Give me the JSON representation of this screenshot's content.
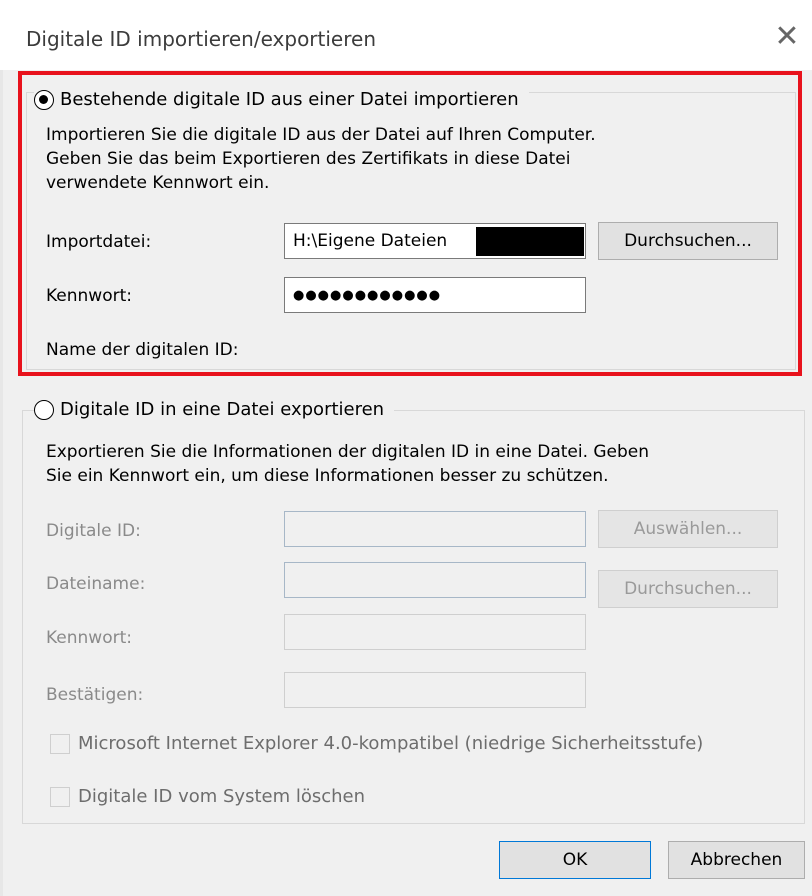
{
  "window": {
    "title": "Digitale ID importieren/exportieren",
    "close_icon": "close-icon"
  },
  "import_section": {
    "radio_label": "Bestehende digitale ID aus einer Datei importieren",
    "selected": true,
    "description_line1": "Importieren Sie die digitale ID aus der Datei auf Ihren Computer.",
    "description_line2": "Geben Sie das beim Exportieren des Zertifikats in diese Datei",
    "description_line3": "verwendete Kennwort ein.",
    "import_file_label": "Importdatei:",
    "import_file_value": "H:\\Eigene Dateien",
    "browse_button": "Durchsuchen...",
    "password_label": "Kennwort:",
    "password_value": "●●●●●●●●●●●●",
    "digital_id_name_label": "Name der digitalen ID:"
  },
  "export_section": {
    "radio_label": "Digitale ID in eine Datei exportieren",
    "selected": false,
    "description_line1": "Exportieren Sie die Informationen der digitalen ID in eine Datei. Geben",
    "description_line2": "Sie ein Kennwort ein, um diese Informationen besser zu schützen.",
    "digital_id_label": "Digitale ID:",
    "select_button": "Auswählen...",
    "filename_label": "Dateiname:",
    "browse_button": "Durchsuchen...",
    "password_label": "Kennwort:",
    "confirm_label": "Bestätigen:",
    "ie_compat_checkbox": "Microsoft Internet Explorer 4.0-kompatibel (niedrige Sicherheitsstufe)",
    "delete_checkbox": "Digitale ID vom System löschen"
  },
  "footer": {
    "ok_button": "OK",
    "cancel_button": "Abbrechen"
  },
  "colors": {
    "highlight": "#e8121c",
    "dialog_bg": "#f0f0f0",
    "disabled_text": "#8a8a8a"
  }
}
